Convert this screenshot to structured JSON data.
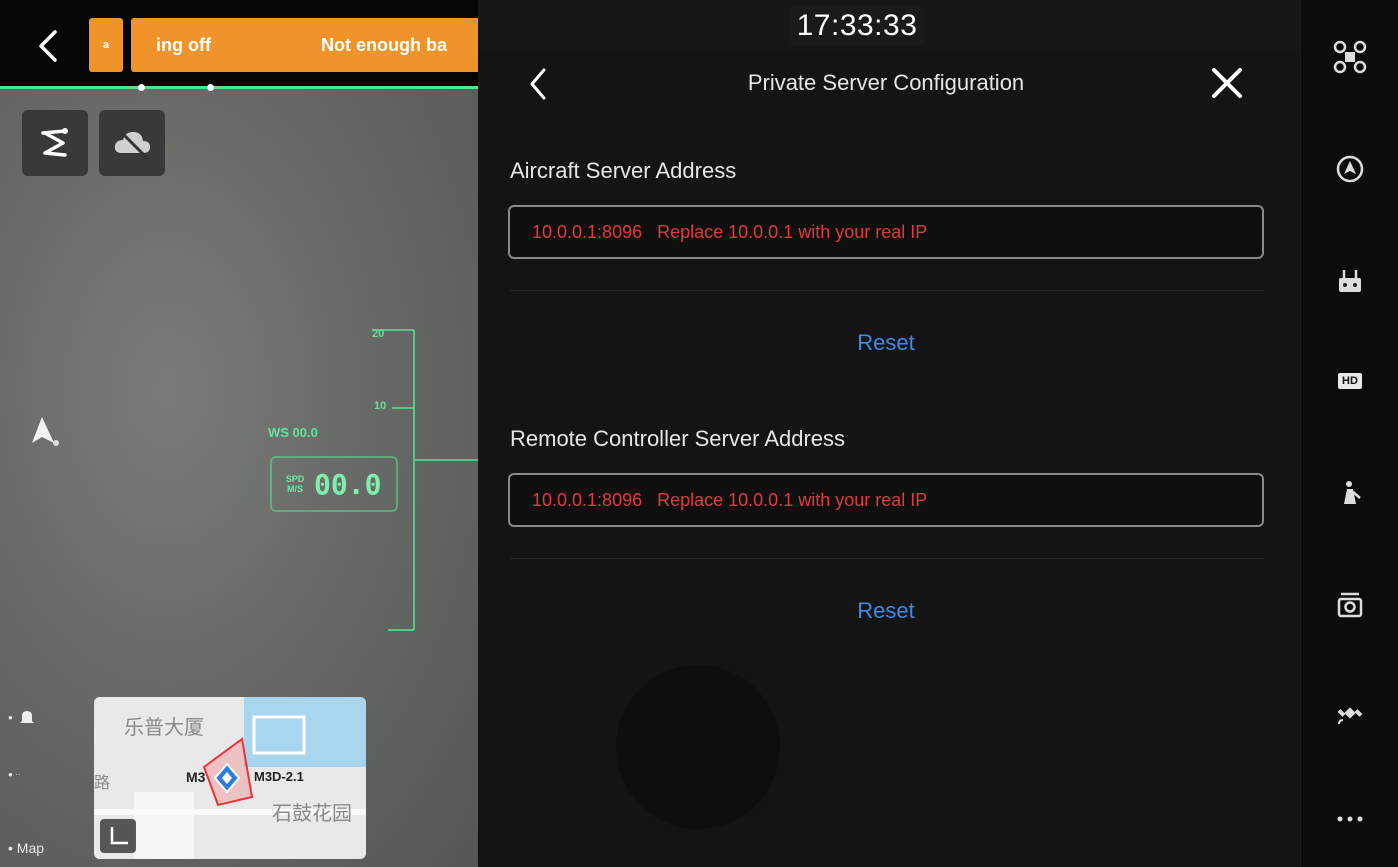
{
  "camera": {
    "warning_small": "a",
    "warning_text_1": "ing off",
    "warning_text_2": "Not enough ba",
    "hud": {
      "ws_label": "WS 00.0",
      "speed_unit": "SPD M/S",
      "speed_value": "00.0",
      "tick_top": "20",
      "tick_mid": "10"
    },
    "left_rail": {
      "map_label": "• Map"
    },
    "mini_map": {
      "place_1": "乐普大厦",
      "place_2": "石鼓花园",
      "place_3": "路",
      "aircraft_label": "M3",
      "aircraft_id": "M3D-2.1"
    }
  },
  "clock": "17:33:33",
  "panel": {
    "title": "Private Server Configuration",
    "aircraft": {
      "label": "Aircraft Server Address",
      "placeholder": "10.0.0.1:8096   Replace 10.0.0.1 with your real IP",
      "reset_label": "Reset"
    },
    "remote_controller": {
      "label": "Remote Controller Server Address",
      "placeholder": "10.0.0.1:8096   Replace 10.0.0.1 with your real IP",
      "reset_label": "Reset"
    }
  },
  "sidebar": {
    "items": [
      {
        "icon": "drone-icon"
      },
      {
        "icon": "compass-icon"
      },
      {
        "icon": "remote-controller-icon"
      },
      {
        "icon": "hd-icon",
        "label": "HD"
      },
      {
        "icon": "gimbal-icon"
      },
      {
        "icon": "camera-icon"
      },
      {
        "icon": "satellite-icon"
      },
      {
        "icon": "more-icon"
      }
    ]
  },
  "colors": {
    "warning": "#f0932a",
    "hud_green": "#55e08f",
    "field_text": "#e23a3a",
    "link_blue": "#3d8be6"
  }
}
